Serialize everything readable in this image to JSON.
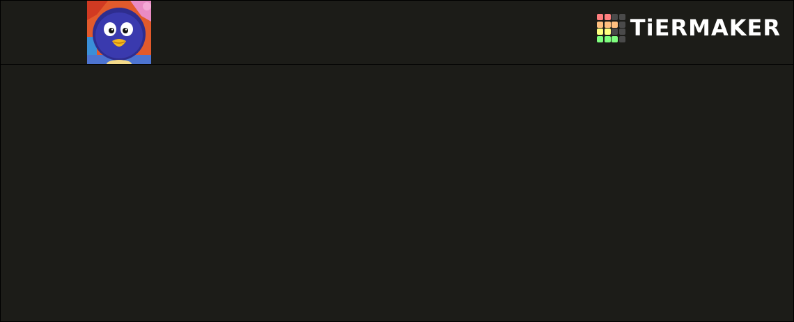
{
  "brand": {
    "name": "TiERMAKER",
    "logo_grid_colors": [
      "#ff7f7f",
      "#ff7f7f",
      "#4a4a4a",
      "#4a4a4a",
      "#ffbf7f",
      "#ffbf7f",
      "#ffbf7f",
      "#4a4a4a",
      "#ffff7f",
      "#ffff7f",
      "#4a4a4a",
      "#4a4a4a",
      "#7fff7f",
      "#7fff7f",
      "#7fff7f",
      "#4a4a4a"
    ]
  },
  "tiers": [
    {
      "label": "",
      "items": [
        {
          "icon": "blue-penguin-character-image"
        }
      ]
    }
  ],
  "colors": {
    "background": "#1c1c18",
    "border": "#000000"
  }
}
